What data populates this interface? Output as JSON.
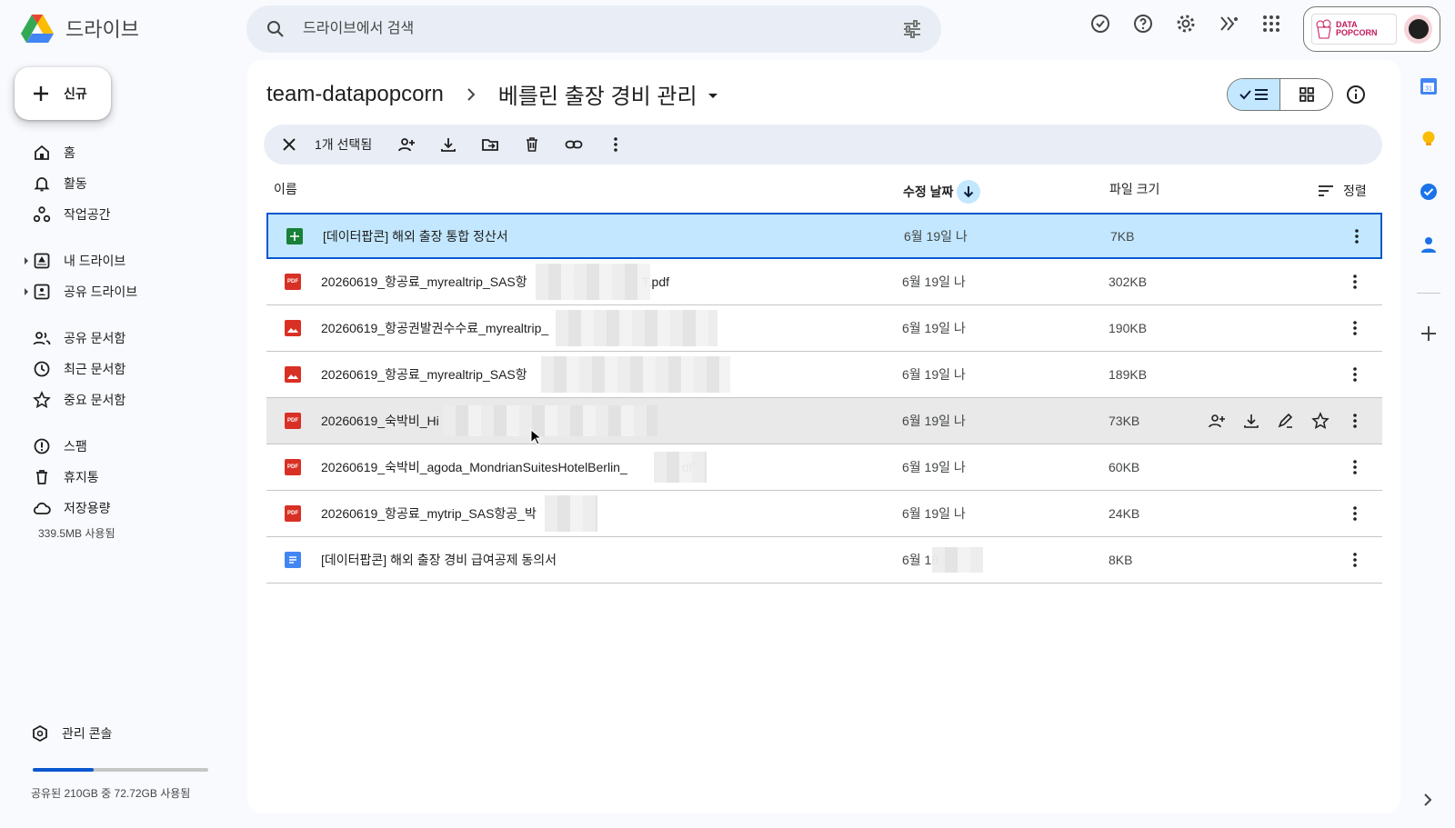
{
  "app": {
    "title": "드라이브"
  },
  "search": {
    "placeholder": "드라이브에서 검색"
  },
  "account": {
    "brand_line1": "DATA",
    "brand_line2": "POPCORN"
  },
  "sidebar": {
    "new_label": "신규",
    "items": [
      {
        "label": "홈",
        "icon": "home-icon"
      },
      {
        "label": "활동",
        "icon": "bell-icon"
      },
      {
        "label": "작업공간",
        "icon": "workspace-icon"
      },
      {
        "label": "내 드라이브",
        "icon": "my-drive-icon"
      },
      {
        "label": "공유 드라이브",
        "icon": "shared-drive-icon"
      },
      {
        "label": "공유 문서함",
        "icon": "people-icon"
      },
      {
        "label": "최근 문서함",
        "icon": "clock-icon"
      },
      {
        "label": "중요 문서함",
        "icon": "star-icon"
      },
      {
        "label": "스팸",
        "icon": "spam-icon"
      },
      {
        "label": "휴지통",
        "icon": "trash-icon"
      },
      {
        "label": "저장용량",
        "icon": "cloud-icon"
      }
    ],
    "storage_used": "339.5MB 사용됨",
    "admin_console": "관리 콘솔",
    "quota_text": "공유된 210GB 중 72.72GB 사용됨",
    "quota_fraction": 0.346
  },
  "breadcrumb": {
    "root": "team-datapopcorn",
    "current": "베를린 출장 경비 관리"
  },
  "selection": {
    "count_label": "1개 선택됨"
  },
  "columns": {
    "name": "이름",
    "modified": "수정 날짜",
    "size": "파일 크기",
    "sort": "정렬"
  },
  "files": [
    {
      "name": "[데이터팝콘] 해외 출장 통합 정산서",
      "type": "sheets",
      "modified": "6월 19일 나",
      "size": "7KB",
      "state": "selected"
    },
    {
      "name": "20260619_항공료_myrealtrip_SAS항",
      "name_tail": "T.pdf",
      "type": "pdf",
      "modified": "6월 19일 나",
      "size": "302KB",
      "state": ""
    },
    {
      "name": "20260619_항공권발권수수료_myrealtrip_",
      "type": "image",
      "modified": "6월 19일 나",
      "size": "190KB",
      "state": ""
    },
    {
      "name": "20260619_항공료_myrealtrip_SAS항",
      "type": "image",
      "modified": "6월 19일 나",
      "size": "189KB",
      "state": ""
    },
    {
      "name": "20260619_숙박비_Hi",
      "type": "pdf",
      "modified": "6월 19일 나",
      "size": "73KB",
      "state": "hover"
    },
    {
      "name": "20260619_숙박비_agoda_MondrianSuitesHotelBerlin_",
      "name_tail": "df",
      "type": "pdf",
      "modified": "6월 19일 나",
      "size": "60KB",
      "state": ""
    },
    {
      "name": "20260619_항공료_mytrip_SAS항공_박",
      "type": "pdf",
      "modified": "6월 19일 나",
      "size": "24KB",
      "state": ""
    },
    {
      "name": "[데이터팝콘] 해외 출장 경비 급여공제 동의서",
      "type": "docs",
      "modified": "6월 18",
      "size": "8KB",
      "state": ""
    }
  ],
  "colors": {
    "accent": "#0b57d0",
    "selected_bg": "#c2e7ff",
    "sheets": "#188038",
    "pdf": "#d93025",
    "image": "#d93025",
    "docs": "#4285f4"
  }
}
